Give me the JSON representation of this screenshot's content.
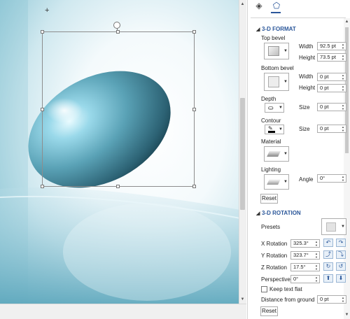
{
  "pane": {
    "tabs": [
      {
        "icon": "fill-bucket-icon"
      },
      {
        "icon": "pentagon-effects-icon"
      }
    ],
    "format_3d": {
      "title": "3-D FORMAT",
      "top_bevel_label": "Top bevel",
      "bottom_bevel_label": "Bottom bevel",
      "width_label": "Width",
      "height_label": "Height",
      "top_width": "92.5 pt",
      "top_height": "73.5 pt",
      "bottom_width": "0 pt",
      "bottom_height": "0 pt",
      "depth_label": "Depth",
      "depth_size_label": "Size",
      "depth_size": "0 pt",
      "contour_label": "Contour",
      "contour_size_label": "Size",
      "contour_size": "0 pt",
      "material_label": "Material",
      "lighting_label": "Lighting",
      "angle_label": "Angle",
      "angle_value": "0°",
      "reset_label": "Reset"
    },
    "rotation_3d": {
      "title": "3-D ROTATION",
      "presets_label": "Presets",
      "x_label": "X Rotation",
      "x_value": "325.3°",
      "y_label": "Y Rotation",
      "y_value": "323.7°",
      "z_label": "Z Rotation",
      "z_value": "17.5°",
      "perspective_label": "Perspective",
      "perspective_value": "0°",
      "keep_text_flat_label": "Keep text flat",
      "distance_label": "Distance from ground",
      "distance_value": "0 pt",
      "reset_label": "Reset"
    }
  },
  "colors": {
    "accent": "#2b579a",
    "egg_light": "#bfeaf5",
    "egg_dark": "#2a5d6e",
    "background_teal": "#7fc3d4"
  }
}
